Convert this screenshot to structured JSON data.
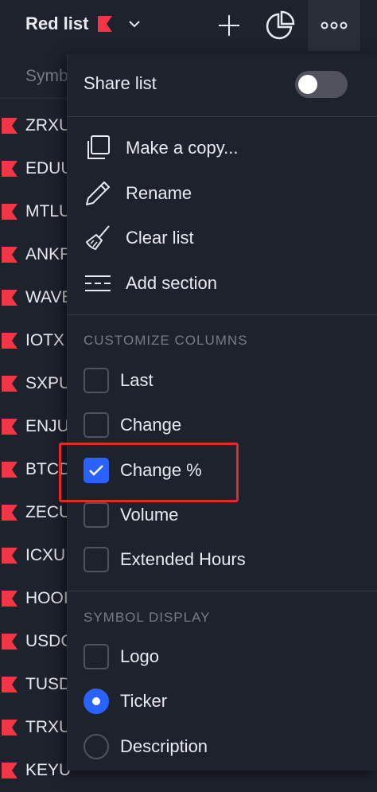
{
  "header": {
    "list_title": "Red list",
    "flag_color": "#f23645",
    "icons": [
      "chevron-down-icon",
      "plus-icon",
      "pie-chart-icon",
      "more-icon"
    ]
  },
  "list": {
    "column_label": "Symb",
    "symbols": [
      "ZRXU",
      "EDUU",
      "MTLU",
      "ANKF",
      "WAVE",
      "IOTX",
      "SXPU",
      "ENJU",
      "BTCD",
      "ZECU",
      "ICXU",
      "HOOI",
      "USDC",
      "TUSD",
      "TRXU",
      "KEYU"
    ]
  },
  "menu": {
    "share_list_label": "Share list",
    "share_list_on": false,
    "actions": [
      {
        "label": "Make a copy...",
        "icon": "copy-icon"
      },
      {
        "label": "Rename",
        "icon": "pencil-icon"
      },
      {
        "label": "Clear list",
        "icon": "broom-icon"
      },
      {
        "label": "Add section",
        "icon": "add-section-icon"
      }
    ],
    "customize_title": "CUSTOMIZE COLUMNS",
    "columns": [
      {
        "label": "Last",
        "checked": false
      },
      {
        "label": "Change",
        "checked": false
      },
      {
        "label": "Change %",
        "checked": true
      },
      {
        "label": "Volume",
        "checked": false
      },
      {
        "label": "Extended Hours",
        "checked": false
      }
    ],
    "display_title": "SYMBOL DISPLAY",
    "display_options": [
      {
        "label": "Logo",
        "type": "checkbox",
        "checked": false
      },
      {
        "label": "Ticker",
        "type": "radio",
        "checked": true
      },
      {
        "label": "Description",
        "type": "radio",
        "checked": false
      }
    ]
  },
  "colors": {
    "accent": "#2962ff",
    "highlight": "#e22a2a",
    "background": "#1e222d"
  }
}
